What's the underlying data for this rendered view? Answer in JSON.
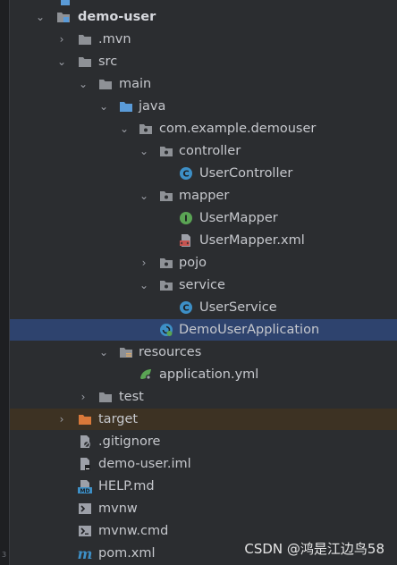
{
  "tree": {
    "items": [
      {
        "label": "demo-user",
        "icon": "module-folder-icon",
        "expanded": true,
        "bold": true
      },
      {
        "label": ".mvn",
        "icon": "folder-icon",
        "expanded": false
      },
      {
        "label": "src",
        "icon": "folder-icon",
        "expanded": true
      },
      {
        "label": "main",
        "icon": "folder-icon",
        "expanded": true
      },
      {
        "label": "java",
        "icon": "source-root-folder-icon",
        "expanded": true
      },
      {
        "label": "com.example.demouser",
        "icon": "package-icon",
        "expanded": true
      },
      {
        "label": "controller",
        "icon": "package-icon",
        "expanded": true
      },
      {
        "label": "UserController",
        "icon": "class-icon"
      },
      {
        "label": "mapper",
        "icon": "package-icon",
        "expanded": true
      },
      {
        "label": "UserMapper",
        "icon": "interface-icon"
      },
      {
        "label": "UserMapper.xml",
        "icon": "xml-file-icon"
      },
      {
        "label": "pojo",
        "icon": "package-icon",
        "expanded": false
      },
      {
        "label": "service",
        "icon": "package-icon",
        "expanded": true
      },
      {
        "label": "UserService",
        "icon": "class-icon"
      },
      {
        "label": "DemoUserApplication",
        "icon": "spring-boot-app-icon",
        "selected": true
      },
      {
        "label": "resources",
        "icon": "resources-folder-icon",
        "expanded": true
      },
      {
        "label": "application.yml",
        "icon": "spring-config-icon"
      },
      {
        "label": "test",
        "icon": "folder-icon",
        "expanded": false
      },
      {
        "label": "target",
        "icon": "excluded-folder-icon",
        "expanded": false
      },
      {
        "label": ".gitignore",
        "icon": "gitignore-file-icon"
      },
      {
        "label": "demo-user.iml",
        "icon": "iml-file-icon"
      },
      {
        "label": "HELP.md",
        "icon": "markdown-file-icon"
      },
      {
        "label": "mvnw",
        "icon": "shell-script-icon"
      },
      {
        "label": "mvnw.cmd",
        "icon": "cmd-file-icon"
      },
      {
        "label": "pom.xml",
        "icon": "maven-pom-icon"
      }
    ]
  },
  "icon_glyphs": {
    "class": "C",
    "interface": "I",
    "markdown": "MD",
    "maven": "m"
  },
  "watermark": "CSDN @鸿是江边鸟58",
  "colors": {
    "background": "#2b2d30",
    "selected_row": "#2e436e",
    "excluded_row": "#3d3223",
    "folder": "#8e9196",
    "source_root": "#5a9bd8",
    "class_icon": "#3d8fc6",
    "interface_icon": "#5aa454",
    "excluded_folder": "#d9793a"
  }
}
